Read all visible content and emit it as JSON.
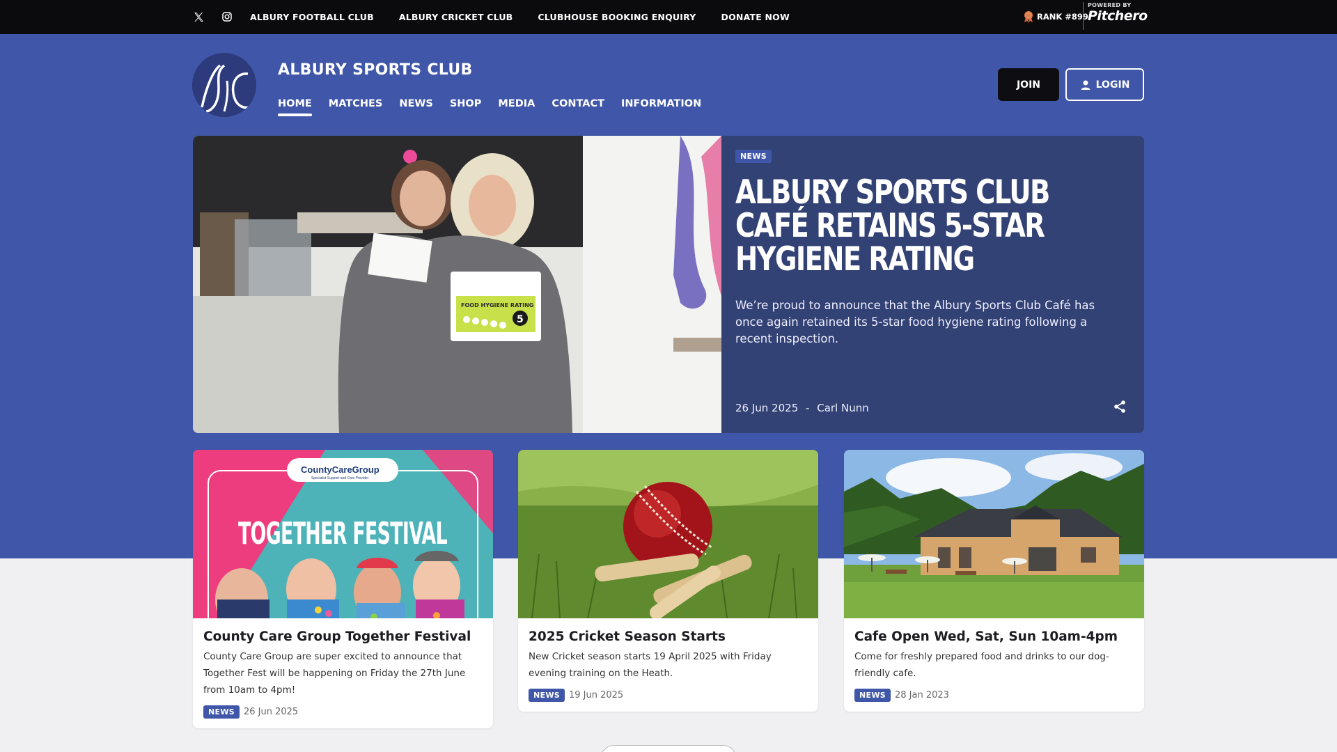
{
  "topbar": {
    "links": [
      "ALBURY FOOTBALL CLUB",
      "ALBURY CRICKET CLUB",
      "CLUBHOUSE BOOKING ENQUIRY",
      "DONATE NOW"
    ],
    "rank": "RANK #899",
    "powered_by": "POWERED BY",
    "brand": "Pitchero"
  },
  "header": {
    "club_name": "ALBURY SPORTS CLUB",
    "nav": [
      "HOME",
      "MATCHES",
      "NEWS",
      "SHOP",
      "MEDIA",
      "CONTACT",
      "INFORMATION"
    ],
    "active_nav": "HOME",
    "join_label": "JOIN",
    "login_label": "LOGIN"
  },
  "hero": {
    "badge": "NEWS",
    "title": "ALBURY SPORTS CLUB CAFÉ RETAINS 5-STAR HYGIENE RATING",
    "description": "We’re proud to announce that the Albury Sports Club Café has once again retained its 5-star food hygiene rating following a recent inspection.",
    "date": "26 Jun 2025",
    "separator": "-",
    "author": "Carl Nunn",
    "image_text": {
      "sign": "FOOD HYGIENE RATING",
      "rating": "5"
    }
  },
  "cards": [
    {
      "title": "County Care Group Together Festival",
      "description": "County Care Group are super excited to announce that Together Fest will be happening on Friday the 27th June from 10am to 4pm!",
      "badge": "NEWS",
      "date": "26 Jun 2025",
      "image_text": {
        "brand": "CountyCareGroup",
        "tagline": "Specialist Support and Care Provider",
        "headline": "TOGETHER FESTIVAL"
      }
    },
    {
      "title": "2025 Cricket Season Starts",
      "description": "New Cricket season starts 19 April 2025 with Friday evening training on the Heath.",
      "badge": "NEWS",
      "date": "19 Jun 2025"
    },
    {
      "title": "Cafe Open Wed, Sat, Sun 10am-4pm",
      "description": "Come for freshly prepared food and drinks to our dog-friendly cafe.",
      "badge": "NEWS",
      "date": "28 Jan 2023"
    }
  ],
  "colors": {
    "brand_blue": "#4056a8",
    "hero_bg": "#334274",
    "topbar": "#0b0b0d"
  },
  "icons": [
    "x-twitter-icon",
    "instagram-icon",
    "rank-medal-icon",
    "user-icon",
    "share-icon"
  ]
}
